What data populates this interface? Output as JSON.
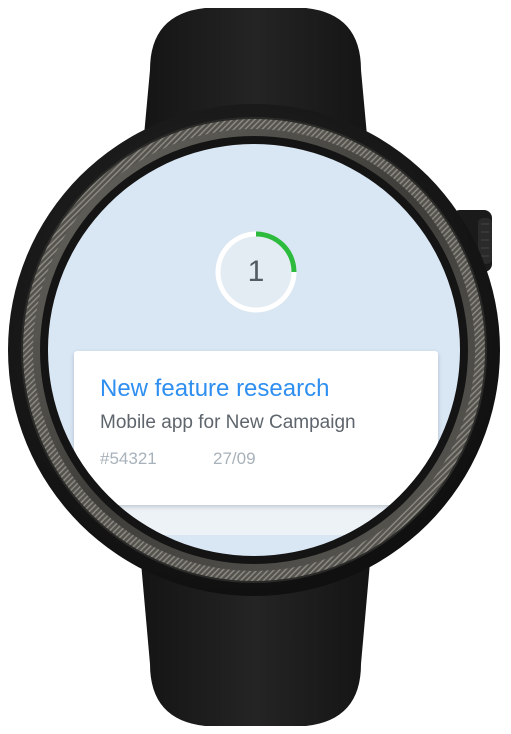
{
  "progress": {
    "count": "1",
    "fraction": 0.25,
    "color": "#2dbb3e"
  },
  "task": {
    "title": "New feature research",
    "subtitle": "Mobile app for New Campaign",
    "id": "#54321",
    "date": "27/09"
  },
  "colors": {
    "screen_background": "#d9e6f3",
    "title": "#2f8ff0",
    "watch_body": "#1c1c1c",
    "bezel": "#4b4a46"
  },
  "icons": {
    "crown": "crown-button-icon"
  }
}
